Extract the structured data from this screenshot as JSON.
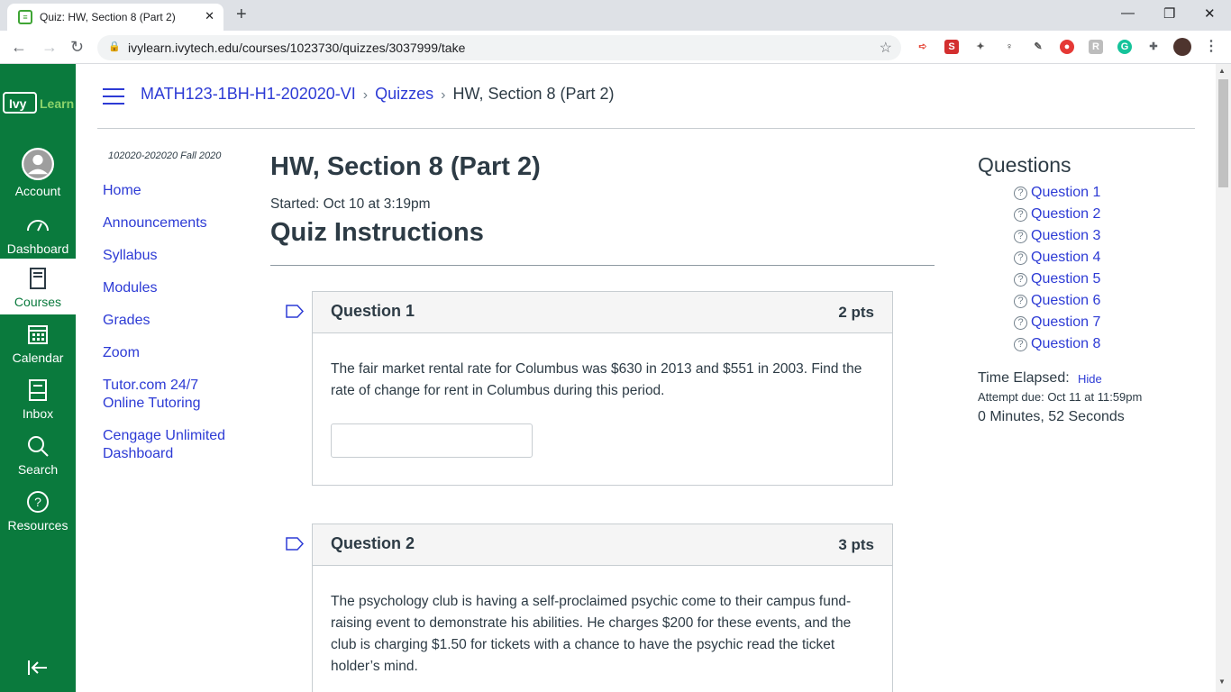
{
  "browser": {
    "tab_title": "Quiz: HW, Section 8 (Part 2)",
    "url": "ivylearn.ivytech.edu/courses/1023730/quizzes/3037999/take"
  },
  "global_nav": {
    "logo_text": "Ivy Learn",
    "items": [
      {
        "label": "Account",
        "icon": "account-avatar-icon"
      },
      {
        "label": "Dashboard",
        "icon": "dashboard-icon"
      },
      {
        "label": "Courses",
        "icon": "courses-icon"
      },
      {
        "label": "Calendar",
        "icon": "calendar-icon"
      },
      {
        "label": "Inbox",
        "icon": "inbox-icon"
      },
      {
        "label": "Search",
        "icon": "search-icon"
      },
      {
        "label": "Resources",
        "icon": "help-icon"
      }
    ],
    "brand_color": "#0a7a3d"
  },
  "breadcrumb": {
    "course": "MATH123-1BH-H1-202020-VI",
    "quizzes": "Quizzes",
    "current": "HW, Section 8 (Part 2)"
  },
  "course_nav": {
    "term": "102020-202020 Fall 2020",
    "links": [
      "Home",
      "Announcements",
      "Syllabus",
      "Modules",
      "Grades",
      "Zoom",
      "Tutor.com 24/7 Online Tutoring",
      "Cengage Unlimited Dashboard"
    ]
  },
  "quiz": {
    "title": "HW, Section 8 (Part 2)",
    "started": "Started: Oct 10 at 3:19pm",
    "instructions_heading": "Quiz Instructions",
    "questions": [
      {
        "name": "Question 1",
        "points": "2 pts",
        "text": "The fair market rental rate for Columbus was $630 in 2013 and $551 in 2003. Find the rate of change for rent in Columbus during this period.",
        "answer": ""
      },
      {
        "name": "Question 2",
        "points": "3 pts",
        "text": "The psychology club is having a self-proclaimed psychic come to their campus fund-raising event to demonstrate his abilities. He charges $200 for these events, and the club is charging $1.50 for tickets with a chance to have the psychic read the ticket holder’s mind."
      }
    ]
  },
  "sidebar": {
    "title": "Questions",
    "question_links": [
      "Question 1",
      "Question 2",
      "Question 3",
      "Question 4",
      "Question 5",
      "Question 6",
      "Question 7",
      "Question 8"
    ],
    "time_elapsed_label": "Time Elapsed:",
    "hide_label": "Hide",
    "attempt_due": "Attempt due: Oct 11 at 11:59pm",
    "timer": "0 Minutes, 52 Seconds"
  }
}
